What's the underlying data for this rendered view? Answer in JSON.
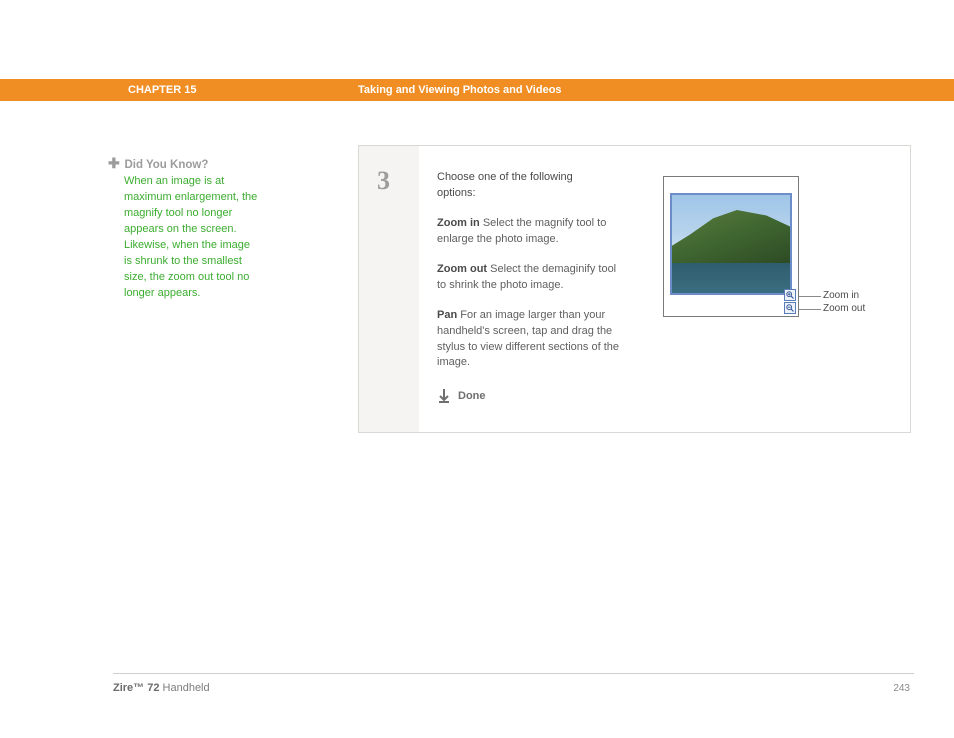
{
  "header": {
    "chapter_label": "CHAPTER 15",
    "chapter_title": "Taking and Viewing Photos and Videos"
  },
  "sidebar": {
    "heading": "Did You Know?",
    "body": "When an image is at maximum enlargement, the magnify tool no longer appears on the screen. Likewise, when the image is shrunk to the smallest size, the zoom out tool no longer appears."
  },
  "step": {
    "number": "3",
    "intro": "Choose one of the following options:",
    "options": [
      {
        "label": "Zoom in",
        "text": "   Select the magnify tool to enlarge the photo image."
      },
      {
        "label": "Zoom out",
        "text": "   Select the demaginify tool to shrink the photo image."
      },
      {
        "label": "Pan",
        "text": "   For an image larger than your handheld's screen, tap and drag the stylus to view different sections of the image."
      }
    ],
    "done": "Done"
  },
  "annotations": {
    "zoom_in": "Zoom in",
    "zoom_out": "Zoom out"
  },
  "footer": {
    "product_bold": "Zire™ 72",
    "product_rest": " Handheld",
    "page": "243"
  }
}
